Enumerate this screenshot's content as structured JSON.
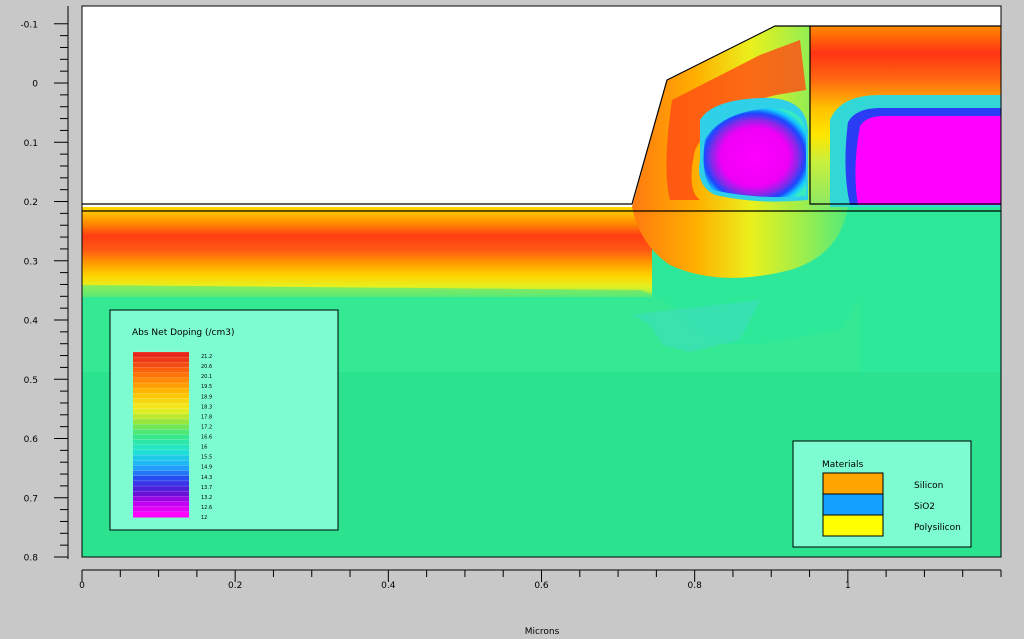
{
  "chart_data": {
    "type": "heatmap",
    "title": "",
    "xlabel": "Microns",
    "ylabel": "",
    "xlim": [
      0,
      1.2
    ],
    "ylim": [
      -0.13,
      0.8
    ],
    "y_inverted": true,
    "x_ticks": [
      "0",
      "0.2",
      "0.4",
      "0.6",
      "0.8",
      "1"
    ],
    "x_tick_values": [
      0,
      0.2,
      0.4,
      0.6,
      0.8,
      1.0
    ],
    "y_ticks": [
      "-0.1",
      "0",
      "0.1",
      "0.2",
      "0.3",
      "0.4",
      "0.5",
      "0.6",
      "0.7",
      "0.8"
    ],
    "y_tick_values": [
      -0.1,
      0,
      0.1,
      0.2,
      0.3,
      0.4,
      0.5,
      0.6,
      0.7,
      0.8
    ],
    "colorbar": {
      "title": "Abs Net Doping (/cm3)",
      "labels": [
        "21.2",
        "20.6",
        "20.1",
        "19.5",
        "18.9",
        "18.3",
        "17.8",
        "17.2",
        "16.6",
        "16",
        "15.5",
        "14.9",
        "14.3",
        "13.7",
        "13.2",
        "12.6",
        "12"
      ]
    },
    "materials": {
      "title": "Materials",
      "items": [
        {
          "name": "Silicon",
          "color": "#ffa500"
        },
        {
          "name": "SiO2",
          "color": "#14a0ff"
        },
        {
          "name": "Polysilicon",
          "color": "#ffff00"
        }
      ]
    },
    "colors": {
      "background_level": "#2ee89a",
      "lower_region": "#2ae48c",
      "peak": "#e8261a",
      "low": "#ff00ff",
      "legend_bg": "#7dfbd1"
    }
  }
}
